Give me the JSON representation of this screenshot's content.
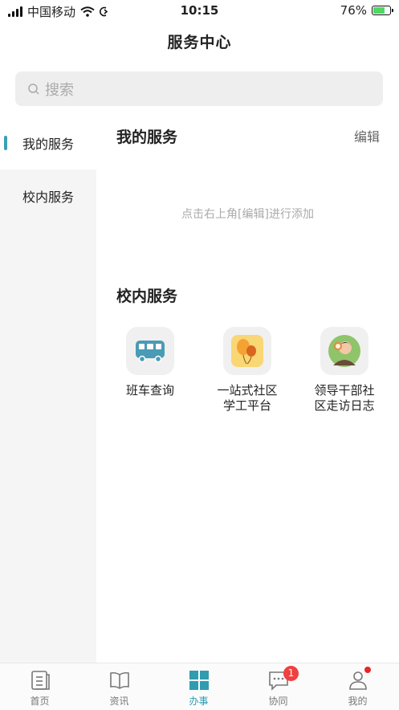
{
  "status_bar": {
    "carrier": "中国移动",
    "time": "10:15",
    "battery": "76%",
    "battery_level": 0.76
  },
  "header": {
    "title": "服务中心"
  },
  "search": {
    "placeholder": "搜索"
  },
  "sidebar": {
    "items": [
      {
        "label": "我的服务",
        "active": true
      },
      {
        "label": "校内服务",
        "active": false
      }
    ]
  },
  "my_services": {
    "title": "我的服务",
    "edit_label": "编辑",
    "empty_hint": "点击右上角[编辑]进行添加"
  },
  "campus_services": {
    "title": "校内服务",
    "items": [
      {
        "line1": "班车查询",
        "line2": "",
        "icon": "bus-icon"
      },
      {
        "line1": "一站式社区",
        "line2": "学工平台",
        "icon": "balloon-icon"
      },
      {
        "line1": "领导干部社",
        "line2": "区走访日志",
        "icon": "leader-avatar-icon"
      }
    ]
  },
  "tabbar": {
    "items": [
      {
        "label": "首页",
        "icon": "home-icon"
      },
      {
        "label": "资讯",
        "icon": "book-icon"
      },
      {
        "label": "办事",
        "icon": "grid-icon",
        "active": true
      },
      {
        "label": "协同",
        "icon": "chat-icon",
        "badge": "1"
      },
      {
        "label": "我的",
        "icon": "user-icon",
        "dot": true
      }
    ]
  },
  "colors": {
    "accent": "#2f9cb0",
    "badge": "#f04040"
  }
}
